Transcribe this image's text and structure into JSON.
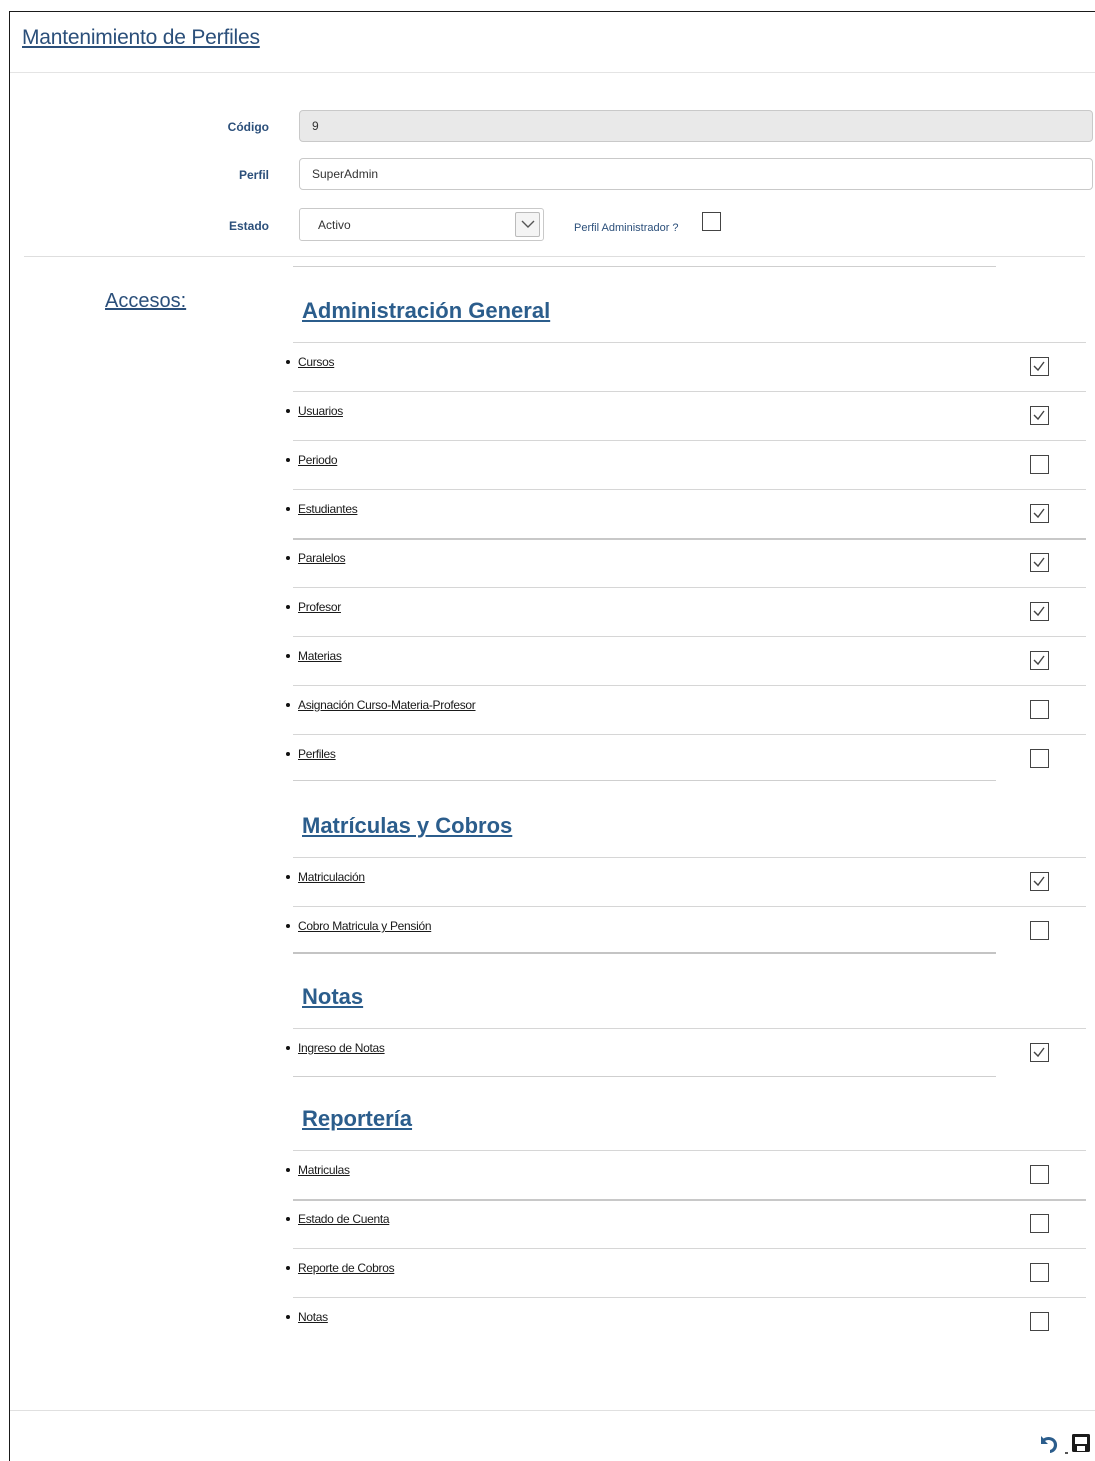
{
  "header": {
    "title": "Mantenimiento de Perfiles"
  },
  "form": {
    "codigo_label": "Código",
    "codigo_value": "9",
    "perfil_label": "Perfil",
    "perfil_value": "SuperAdmin",
    "estado_label": "Estado",
    "estado_value": "Activo",
    "admin_label": "Perfil Administrador ?",
    "admin_checked": false
  },
  "accesos_label": "Accesos:",
  "sections": [
    {
      "title": "Administración General",
      "items": [
        {
          "label": "Cursos",
          "checked": true
        },
        {
          "label": "Usuarios",
          "checked": true
        },
        {
          "label": "Periodo",
          "checked": false
        },
        {
          "label": "Estudiantes",
          "checked": true
        },
        {
          "label": "Paralelos",
          "checked": true
        },
        {
          "label": "Profesor",
          "checked": true
        },
        {
          "label": "Materias",
          "checked": true
        },
        {
          "label": "Asignación Curso-Materia-Profesor",
          "checked": false
        },
        {
          "label": "Perfiles",
          "checked": false
        }
      ]
    },
    {
      "title": "Matrículas y Cobros",
      "items": [
        {
          "label": "Matriculación",
          "checked": true
        },
        {
          "label": "Cobro Matricula y Pensión",
          "checked": false
        }
      ]
    },
    {
      "title": "Notas",
      "items": [
        {
          "label": "Ingreso de Notas",
          "checked": true
        }
      ]
    },
    {
      "title": "Reportería",
      "items": [
        {
          "label": "Matriculas",
          "checked": false
        },
        {
          "label": "Estado de Cuenta",
          "checked": false
        },
        {
          "label": "Reporte de Cobros",
          "checked": false
        },
        {
          "label": "Notas",
          "checked": false
        }
      ]
    }
  ],
  "actions": [
    {
      "name": "undo-icon"
    },
    {
      "name": "save-icon"
    }
  ],
  "colors": {
    "accent": "#2b5d8c",
    "label": "#2b4f7a"
  }
}
